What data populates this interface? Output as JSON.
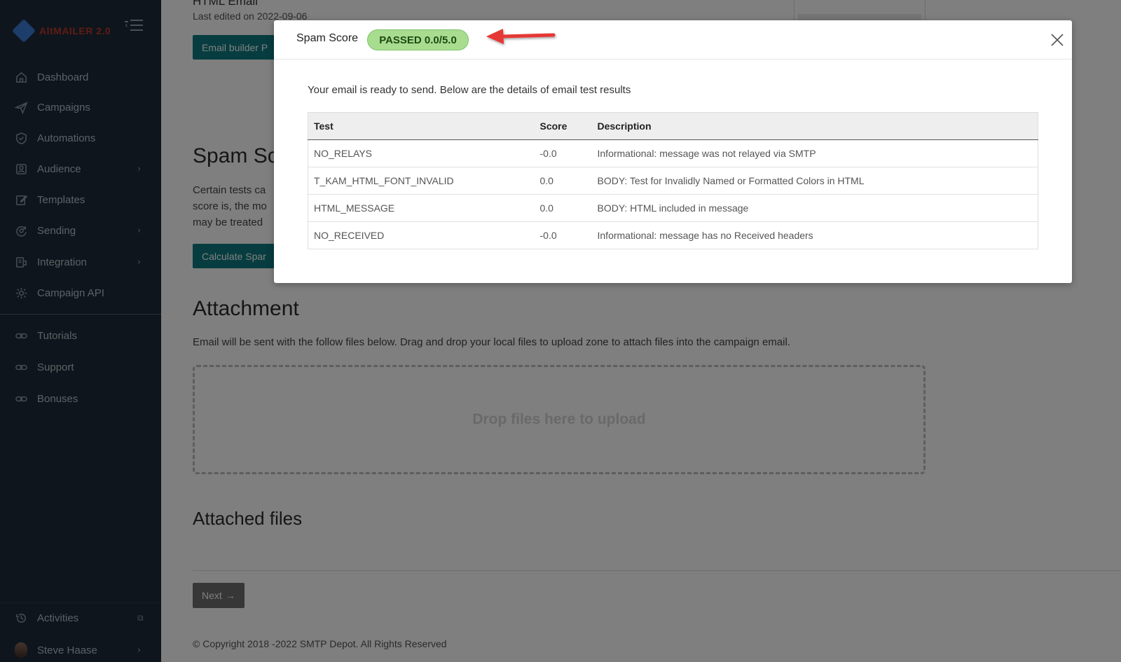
{
  "app": {
    "logo_main": "AltMAILER",
    "logo_version": "2.0"
  },
  "sidebar": {
    "items": [
      {
        "label": "Dashboard",
        "icon": "home-icon"
      },
      {
        "label": "Campaigns",
        "icon": "send-icon"
      },
      {
        "label": "Automations",
        "icon": "shield-check-icon"
      },
      {
        "label": "Audience",
        "icon": "users-icon"
      },
      {
        "label": "Templates",
        "icon": "edit-icon"
      },
      {
        "label": "Sending",
        "icon": "refresh-icon"
      },
      {
        "label": "Integration",
        "icon": "plug-icon"
      },
      {
        "label": "Campaign API",
        "icon": "gear-icon"
      },
      {
        "label": "Tutorials",
        "icon": "link-icon"
      },
      {
        "label": "Support",
        "icon": "link-icon"
      },
      {
        "label": "Bonuses",
        "icon": "link-icon"
      },
      {
        "label": "Activities",
        "icon": "history-icon"
      },
      {
        "label": "Steve Haase",
        "icon": "avatar"
      }
    ]
  },
  "page": {
    "pre_title": "HTML Email",
    "last_edited": "Last edited on 2022-09-06",
    "email_builder_button": "Email builder P",
    "spam_section_title": "Spam Sc",
    "spam_text_lines": [
      "Certain tests ca",
      "score is, the mo",
      "may be treated"
    ],
    "calculate_button": "Calculate Spar",
    "attachment_title": "Attachment",
    "attachment_text": "Email will be sent with the follow files below. Drag and drop your local files to upload zone to attach files into the campaign email.",
    "dropzone_text": "Drop files here to upload",
    "attached_files_title": "Attached files",
    "next_button": "Next",
    "copyright": "© Copyright 2018 -2022 SMTP Depot. All Rights Reserved"
  },
  "modal": {
    "title": "Spam Score",
    "badge": "PASSED 0.0/5.0",
    "intro": "Your email is ready to send. Below are the details of email test results",
    "table": {
      "headers": [
        "Test",
        "Score",
        "Description"
      ],
      "rows": [
        [
          "NO_RELAYS",
          "-0.0",
          "Informational: message was not relayed via SMTP"
        ],
        [
          "T_KAM_HTML_FONT_INVALID",
          "0.0",
          "BODY: Test for Invalidly Named or Formatted Colors in HTML"
        ],
        [
          "HTML_MESSAGE",
          "0.0",
          "BODY: HTML included in message"
        ],
        [
          "NO_RECEIVED",
          "-0.0",
          "Informational: message has no Received headers"
        ]
      ]
    }
  },
  "colors": {
    "sidebar_bg": "#1e2b38",
    "accent_teal": "#0f7b80",
    "badge_green": "#a8dc8f",
    "arrow_red": "#e53935"
  }
}
